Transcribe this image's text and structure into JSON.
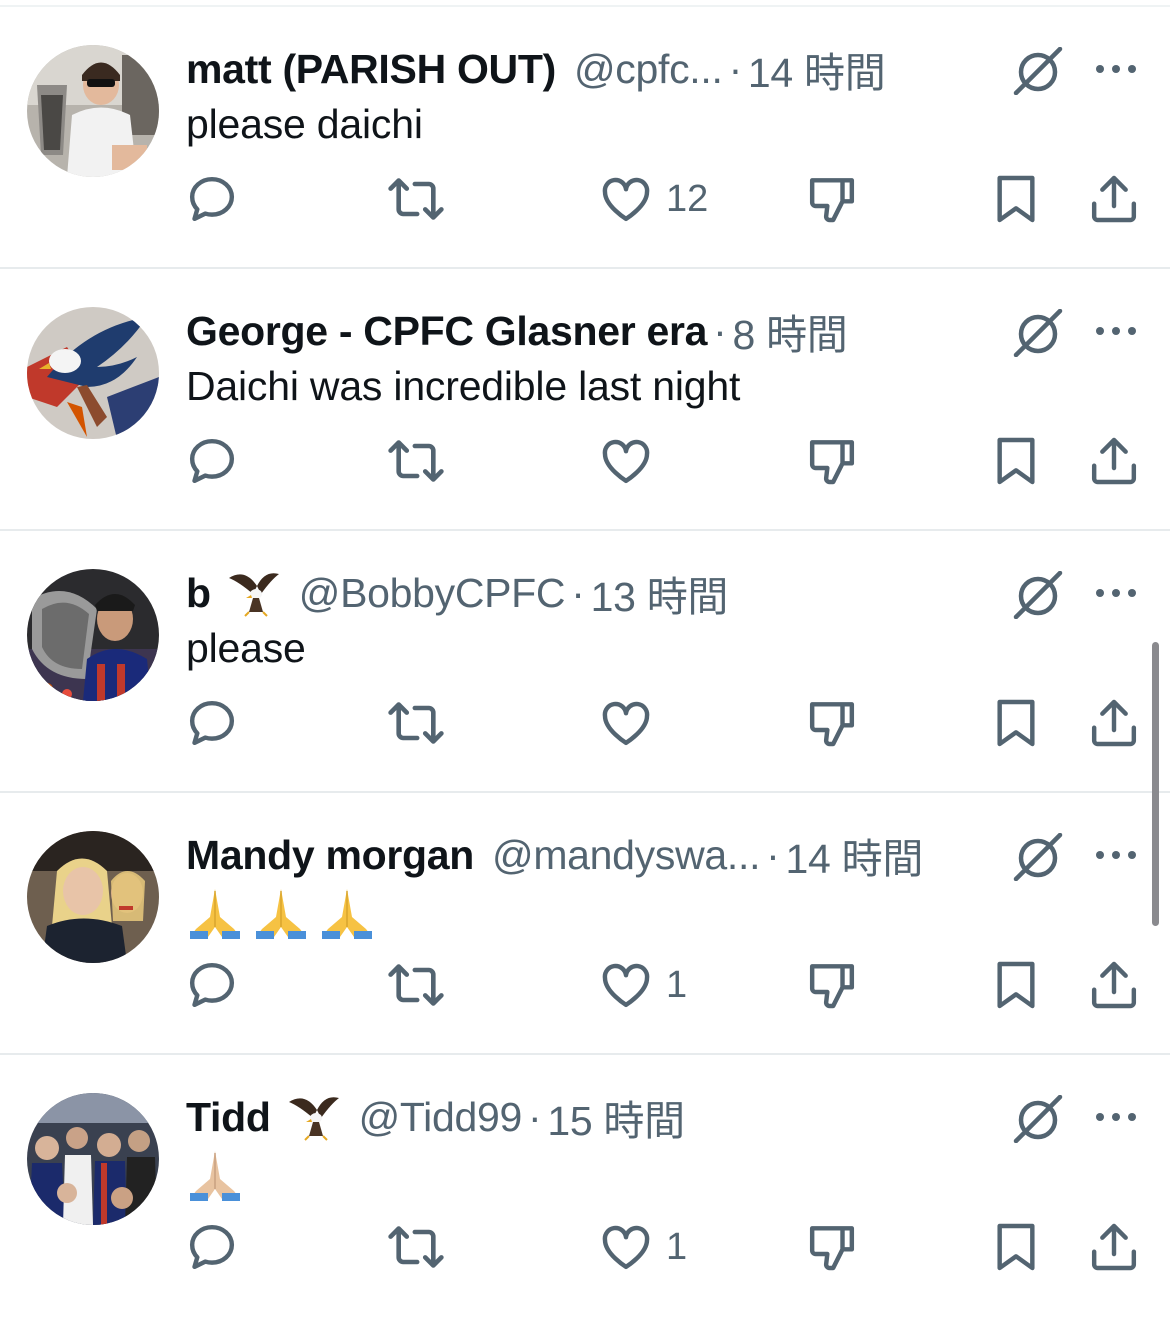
{
  "colors": {
    "text_primary": "#0f1419",
    "text_secondary": "#536471",
    "icon": "#536471",
    "divider": "#e7ebed"
  },
  "posts": [
    {
      "display_name": "matt (PARISH OUT)",
      "handle": "@cpfc...",
      "separator": "·",
      "time": "14 時間",
      "text": "please daichi",
      "reply_count": "",
      "repost_count": "",
      "like_count": "12",
      "has_eagle": false,
      "emoji": ""
    },
    {
      "display_name": "George - CPFC Glasner era",
      "handle": "",
      "separator": "·",
      "time": "8 時間",
      "text": "Daichi was incredible last night",
      "reply_count": "",
      "repost_count": "",
      "like_count": "",
      "has_eagle": false,
      "emoji": ""
    },
    {
      "display_name": "b",
      "handle": "@BobbyCPFC",
      "separator": "·",
      "time": "13 時間",
      "text": "please",
      "reply_count": "",
      "repost_count": "",
      "like_count": "",
      "has_eagle": true,
      "emoji": ""
    },
    {
      "display_name": "Mandy morgan",
      "handle": "@mandyswa...",
      "separator": "·",
      "time": "14 時間",
      "text": "",
      "reply_count": "",
      "repost_count": "",
      "like_count": "1",
      "has_eagle": false,
      "emoji": "🙏🙏🙏"
    },
    {
      "display_name": "Tidd",
      "handle": "@Tidd99",
      "separator": "·",
      "time": "15 時間",
      "text": "",
      "reply_count": "",
      "repost_count": "",
      "like_count": "1",
      "has_eagle": true,
      "emoji": "🙏🏼"
    }
  ]
}
